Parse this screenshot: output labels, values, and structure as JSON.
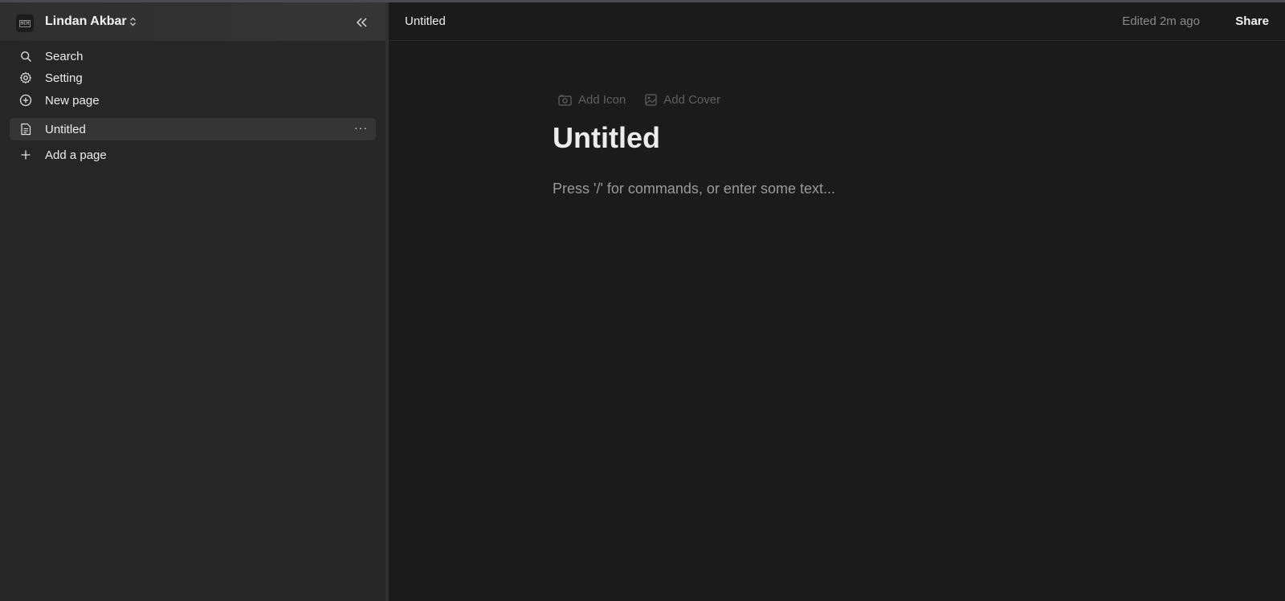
{
  "sidebar": {
    "workspace": {
      "logo_text": "MEM",
      "name": "Lindan Akbar"
    },
    "actions": [
      {
        "label": "Search",
        "icon": "search-icon"
      },
      {
        "label": "Setting",
        "icon": "gear-icon"
      },
      {
        "label": "New page",
        "icon": "plus-circle-icon"
      }
    ],
    "pages": [
      {
        "label": "Untitled",
        "icon": "document-icon",
        "more": "···"
      }
    ],
    "add_page_label": "Add a page"
  },
  "header": {
    "breadcrumb": "Untitled",
    "edited": "Edited 2m ago",
    "share": "Share"
  },
  "editor": {
    "add_icon": "Add Icon",
    "add_cover": "Add Cover",
    "title": "Untitled",
    "placeholder": "Press '/' for commands, or enter some text..."
  },
  "colors": {
    "sidebar_bg": "#262626",
    "main_bg": "#1b1b1b",
    "text": "#ececec",
    "muted": "#8a8a8a"
  }
}
